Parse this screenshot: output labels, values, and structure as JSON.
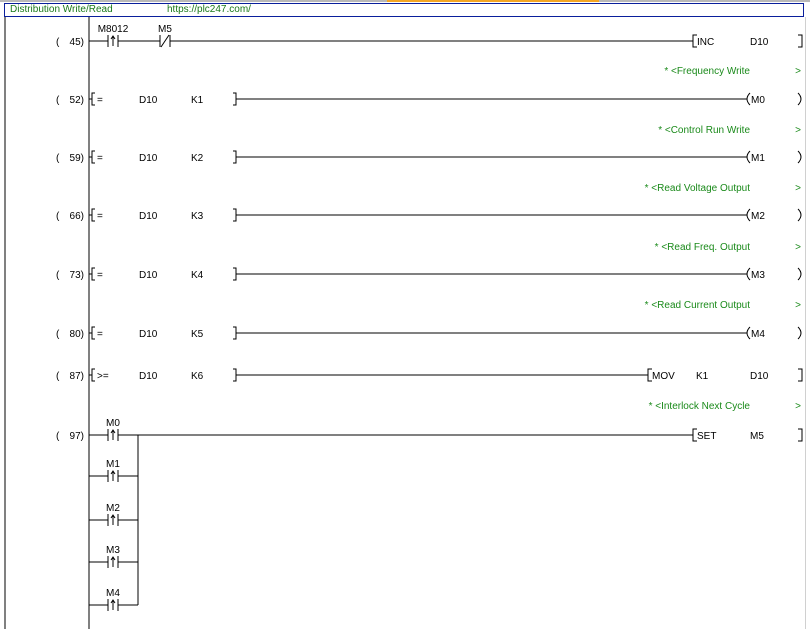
{
  "header": {
    "title": "Distribution Write/Read",
    "url": "https://plc247.com/"
  },
  "rungs": [
    {
      "step": "45",
      "contacts": [
        {
          "label": "M8012",
          "type": "pulse"
        },
        {
          "label": "M5",
          "type": "nc"
        }
      ],
      "instruction": {
        "kind": "bracket",
        "op": "INC",
        "args": [
          "D10"
        ]
      }
    },
    {
      "comment": "* <Frequency Write",
      "marker": ">"
    },
    {
      "step": "52",
      "compare": {
        "op": "=",
        "a": "D10",
        "b": "K1"
      },
      "instruction": {
        "kind": "coil",
        "name": "M0"
      }
    },
    {
      "comment": "* <Control Run Write",
      "marker": ">"
    },
    {
      "step": "59",
      "compare": {
        "op": "=",
        "a": "D10",
        "b": "K2"
      },
      "instruction": {
        "kind": "coil",
        "name": "M1"
      }
    },
    {
      "comment": "* <Read Voltage Output",
      "marker": ">"
    },
    {
      "step": "66",
      "compare": {
        "op": "=",
        "a": "D10",
        "b": "K3"
      },
      "instruction": {
        "kind": "coil",
        "name": "M2"
      }
    },
    {
      "comment": "* <Read Freq. Output",
      "marker": ">"
    },
    {
      "step": "73",
      "compare": {
        "op": "=",
        "a": "D10",
        "b": "K4"
      },
      "instruction": {
        "kind": "coil",
        "name": "M3"
      }
    },
    {
      "comment": "* <Read Current Output",
      "marker": ">"
    },
    {
      "step": "80",
      "compare": {
        "op": "=",
        "a": "D10",
        "b": "K5"
      },
      "instruction": {
        "kind": "coil",
        "name": "M4"
      }
    },
    {
      "step": "87",
      "compare": {
        "op": ">=",
        "a": "D10",
        "b": "K6"
      },
      "instruction": {
        "kind": "bracket",
        "op": "MOV",
        "args": [
          "K1",
          "D10"
        ]
      }
    },
    {
      "comment": "* <Interlock Next Cycle",
      "marker": ">"
    },
    {
      "step": "97",
      "contacts": [
        {
          "label": "M0",
          "type": "pulse"
        }
      ],
      "parallel": [
        "M1",
        "M2",
        "M3",
        "M4"
      ],
      "instruction": {
        "kind": "bracket",
        "op": "SET",
        "args": [
          "M5"
        ]
      }
    }
  ],
  "colors": {
    "comment": "#1a8a1a",
    "header_border": "#0a1f9c",
    "accent": "#f5a623"
  }
}
